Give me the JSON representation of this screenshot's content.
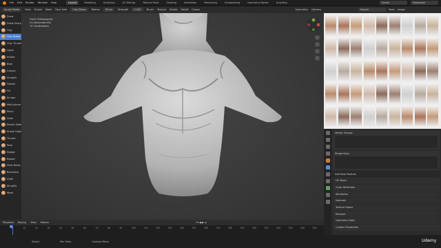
{
  "topbar": {
    "menus": [
      "File",
      "Edit",
      "Render",
      "Window",
      "Help"
    ],
    "tabs": [
      {
        "label": "Layout",
        "active": true
      },
      {
        "label": "Modeling",
        "active": false
      },
      {
        "label": "Sculpting",
        "active": false
      },
      {
        "label": "UV Editing",
        "active": false
      },
      {
        "label": "Texture Paint",
        "active": false
      },
      {
        "label": "Shading",
        "active": false
      },
      {
        "label": "Animation",
        "active": false
      },
      {
        "label": "Rendering",
        "active": false
      },
      {
        "label": "Compositing",
        "active": false
      },
      {
        "label": "Geometry Nodes",
        "active": false
      },
      {
        "label": "Scripting",
        "active": false
      }
    ],
    "scene": "Scene",
    "view_layer": "ViewLayer"
  },
  "tool_header": {
    "mode": "Sculpt Mode",
    "view": "View",
    "sculpt": "Sculpt",
    "mask": "Mask",
    "face_sets": "Face Sets",
    "active_brush": "Clay Strips",
    "radius_label": "Radius",
    "radius_value": "50 px",
    "strength_label": "Strength",
    "strength_value": "0.500",
    "brush_menu": "Brush",
    "texture_menu": "Texture",
    "stroke_menu": "Stroke",
    "falloff_menu": "Falloff",
    "cursor_menu": "Cursor",
    "symmetry": "Symmetry",
    "options": "Options"
  },
  "viewport": {
    "info_line1": "Front Orthographic",
    "info_line2": "(1) Decimate.001",
    "info_line3": "10 Centimeters"
  },
  "brushes": [
    {
      "label": "Draw",
      "active": false
    },
    {
      "label": "Draw Sharp",
      "active": false
    },
    {
      "label": "Clay",
      "active": false
    },
    {
      "label": "Clay Strips",
      "active": true
    },
    {
      "label": "Clay Thumb",
      "active": false
    },
    {
      "label": "Layer",
      "active": false
    },
    {
      "label": "Inflate",
      "active": false
    },
    {
      "label": "Blob",
      "active": false
    },
    {
      "label": "Crease",
      "active": false
    },
    {
      "label": "Smooth",
      "active": false
    },
    {
      "label": "Flatten",
      "active": false
    },
    {
      "label": "Fill",
      "active": false
    },
    {
      "label": "Scrape",
      "active": false
    },
    {
      "label": "Multi-plane Scrape",
      "active": false
    },
    {
      "label": "Pinch",
      "active": false
    },
    {
      "label": "Grab",
      "active": false
    },
    {
      "label": "Elastic Deform",
      "active": false
    },
    {
      "label": "Snake Hook",
      "active": false
    },
    {
      "label": "Thumb",
      "active": false
    },
    {
      "label": "Pose",
      "active": false
    },
    {
      "label": "Nudge",
      "active": false
    },
    {
      "label": "Rotate",
      "active": false
    },
    {
      "label": "Slide Relax",
      "active": false
    },
    {
      "label": "Boundary",
      "active": false
    },
    {
      "label": "Cloth",
      "active": false
    },
    {
      "label": "Simplify",
      "active": false
    },
    {
      "label": "Mask",
      "active": false
    }
  ],
  "timeline": {
    "menus": [
      "Playback",
      "Keying",
      "View",
      "Marker"
    ],
    "current_frame": "1",
    "ticks": [
      "1",
      "10",
      "20",
      "30",
      "40",
      "50",
      "60",
      "70",
      "80",
      "90",
      "100",
      "110",
      "120",
      "130",
      "140",
      "150",
      "160",
      "170",
      "180",
      "190",
      "200",
      "210",
      "220",
      "230",
      "240",
      "250"
    ]
  },
  "reference_panel": {
    "search": "Search",
    "view": "View",
    "image": "Image"
  },
  "properties": {
    "vertex_groups": "Vertex Groups",
    "shape_keys": "Shape Keys",
    "add_rest_position": "Add Rest Position",
    "sections": [
      "UV Maps",
      "Color Attributes",
      "Attributes",
      "Normals",
      "Texture Space",
      "Remesh",
      "Geometry Data",
      "Custom Properties"
    ]
  },
  "statusbar": {
    "select": "Select",
    "pan_view": "Pan View",
    "context_menu": "Context Menu"
  },
  "branding": "Udemy",
  "colors": {
    "accent": "#4a7fd1",
    "viewport_bg": "#3a3a3a",
    "sculpt_clay": "#cfcfcf"
  }
}
